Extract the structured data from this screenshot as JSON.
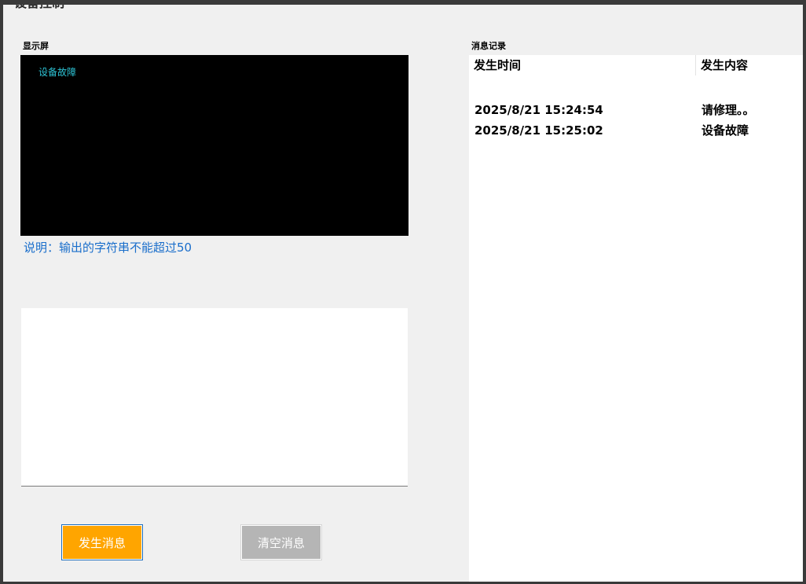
{
  "window": {
    "title": "设备控制"
  },
  "display": {
    "label": "显示屏",
    "screen_text": "设备故障",
    "hint": "说明：输出的字符串不能超过50"
  },
  "input": {
    "value": "",
    "placeholder": ""
  },
  "buttons": {
    "send_label": "发生消息",
    "clear_label": "清空消息"
  },
  "log": {
    "label": "消息记录",
    "columns": [
      "发生时间",
      "发生内容"
    ],
    "rows": [
      {
        "time": "2025/8/21 15:24:54",
        "content": "请修理。。"
      },
      {
        "time": "2025/8/21 15:25:02",
        "content": "设备故障"
      }
    ]
  },
  "colors": {
    "send_button": "#ffa500",
    "clear_button": "#b5b5b5",
    "screen_background": "#000000",
    "screen_text": "#2ec4d6",
    "hint_text": "#1a6ecb"
  }
}
